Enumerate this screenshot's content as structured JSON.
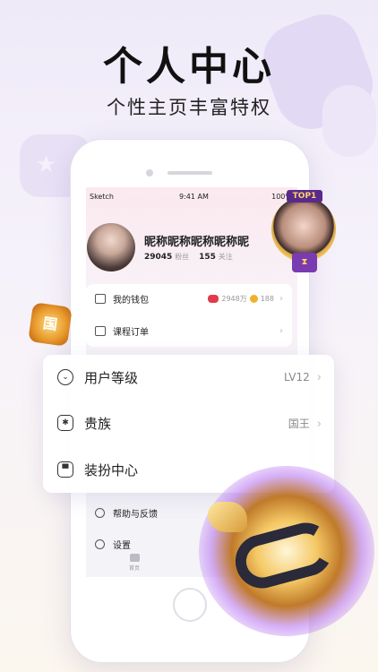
{
  "promo": {
    "headline": "个人中心",
    "subline": "个性主页丰富特权"
  },
  "status_bar": {
    "carrier": "Sketch",
    "time": "9:41 AM",
    "battery": "100%"
  },
  "profile": {
    "nickname": "昵称昵称昵称昵称昵",
    "fans_count": "29045",
    "fans_label": "粉丝",
    "follow_count": "155",
    "follow_label": "关注"
  },
  "badge": {
    "top_text": "TOP1"
  },
  "card1": {
    "wallet_label": "我的钱包",
    "wallet_gems": "2948万",
    "wallet_coins": "188",
    "course_label": "课程订单"
  },
  "bigcard": {
    "level_label": "用户等级",
    "level_value": "LV12",
    "noble_label": "贵族",
    "noble_value": "国王",
    "dress_label": "装扮中心"
  },
  "lower": {
    "help_label": "帮助与反馈",
    "settings_label": "设置",
    "tab_home_label": "首页"
  },
  "guo_badge": "国",
  "colors": {
    "accent_gem": "#e23b4b",
    "accent_coin": "#f2b02a",
    "badge_purple": "#5a2a8a"
  }
}
